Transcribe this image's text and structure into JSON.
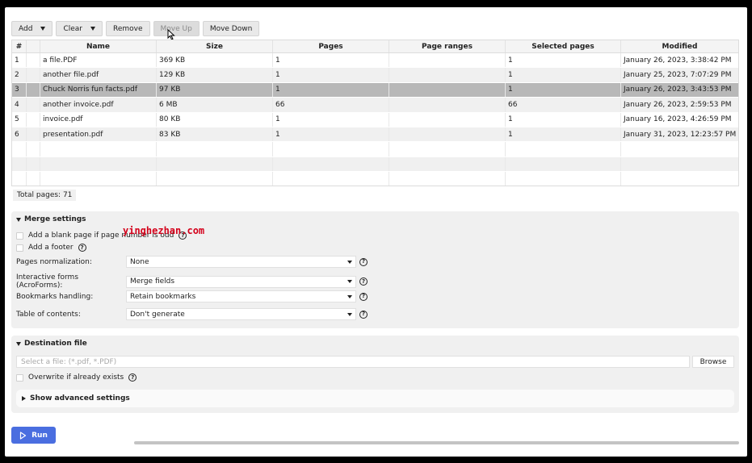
{
  "toolbar": {
    "add_label": "Add",
    "clear_label": "Clear",
    "remove_label": "Remove",
    "move_up_label": "Move Up",
    "move_down_label": "Move Down"
  },
  "table": {
    "headers": [
      "#",
      "",
      "Name",
      "Size",
      "Pages",
      "Page ranges",
      "Selected pages",
      "Modified"
    ],
    "rows": [
      {
        "num": "1",
        "name": "a file.PDF",
        "size": "369 KB",
        "pages": "1",
        "ranges": "",
        "selected": "1",
        "modified": "January 26, 2023, 3:38:42 PM"
      },
      {
        "num": "2",
        "name": "another file.pdf",
        "size": "129 KB",
        "pages": "1",
        "ranges": "",
        "selected": "1",
        "modified": "January 25, 2023, 7:07:29 PM"
      },
      {
        "num": "3",
        "name": "Chuck Norris fun facts.pdf",
        "size": "97 KB",
        "pages": "1",
        "ranges": "",
        "selected": "1",
        "modified": "January 26, 2023, 3:43:53 PM"
      },
      {
        "num": "4",
        "name": "another invoice.pdf",
        "size": "6 MB",
        "pages": "66",
        "ranges": "",
        "selected": "66",
        "modified": "January 26, 2023, 2:59:53 PM"
      },
      {
        "num": "5",
        "name": "invoice.pdf",
        "size": "80 KB",
        "pages": "1",
        "ranges": "",
        "selected": "1",
        "modified": "January 16, 2023, 4:26:59 PM"
      },
      {
        "num": "6",
        "name": "presentation.pdf",
        "size": "83 KB",
        "pages": "1",
        "ranges": "",
        "selected": "1",
        "modified": "January 31, 2023, 12:23:57 PM"
      }
    ],
    "selected_row": "3"
  },
  "total_pages": "Total pages: 71",
  "merge": {
    "title": "Merge settings",
    "blank_page_label": "Add a blank page if page number is odd",
    "footer_label": "Add a footer",
    "normalization_label": "Pages normalization:",
    "normalization_value": "None",
    "forms_label": "Interactive forms (AcroForms):",
    "forms_value": "Merge fields",
    "bookmarks_label": "Bookmarks handling:",
    "bookmarks_value": "Retain bookmarks",
    "toc_label": "Table of contents:",
    "toc_value": "Don't generate"
  },
  "destination": {
    "title": "Destination file",
    "file_placeholder": "Select a file: (*.pdf, *.PDF)",
    "browse_label": "Browse",
    "overwrite_label": "Overwrite if already exists",
    "advanced_label": "Show advanced settings"
  },
  "run_label": "Run",
  "watermark_text": "yinghezhan.com",
  "colors": {
    "accent": "#4a6ee0",
    "selected_row": "#b8b8b8",
    "panel_bg": "#f0f0f0"
  }
}
